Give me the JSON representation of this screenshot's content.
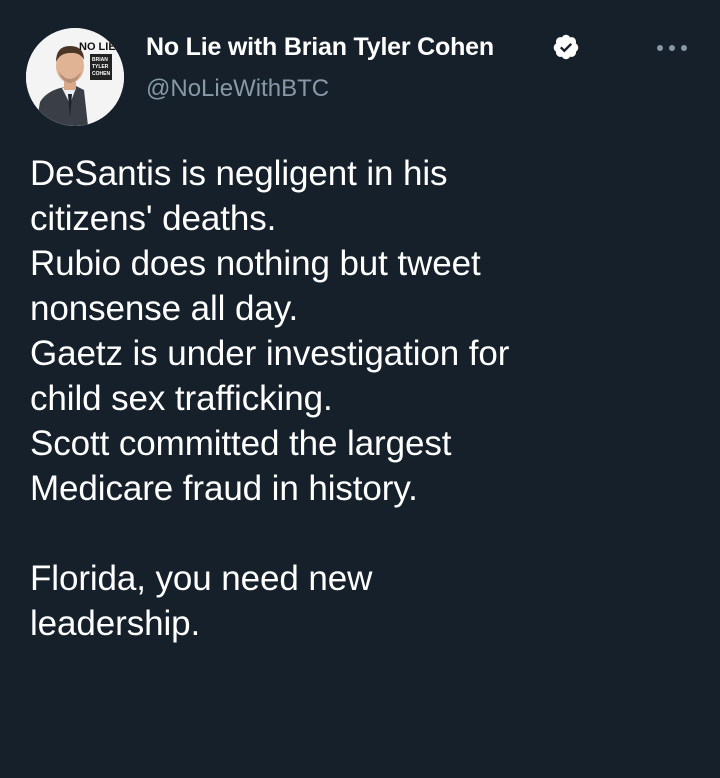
{
  "author": {
    "name": "No Lie with Brian Tyler Cohen",
    "handle": "@NoLieWithBTC",
    "verified": true,
    "avatar_badge_line1": "NO LIE",
    "avatar_badge_line2": "BRIAN TYLER COHEN"
  },
  "tweet": {
    "text": "DeSantis is negligent in his\ncitizens' deaths.\nRubio does nothing but tweet\nnonsense all day.\nGaetz is under investigation for\nchild sex trafficking.\nScott committed the largest\nMedicare fraud in history.\n\nFlorida, you need new\nleadership."
  },
  "icons": {
    "verified": "verified-badge-icon",
    "more": "more-options-icon"
  },
  "colors": {
    "background": "#15202b",
    "text": "#ffffff",
    "secondary_text": "#8899a6",
    "verified_fill": "#ffffff"
  }
}
